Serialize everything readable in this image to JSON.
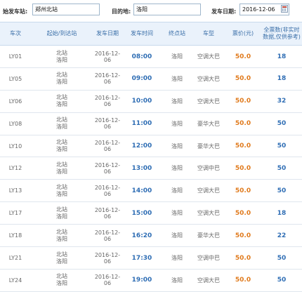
{
  "search": {
    "from_label": "始发车站:",
    "from_value": "郑州北站",
    "to_label": "目的地:",
    "to_value": "洛阳",
    "date_label": "发车日期:",
    "date_value": "2016-12-06"
  },
  "table": {
    "headers": [
      "车次",
      "起始/到达站",
      "发车日期",
      "发车时间",
      "终点站",
      "车型",
      "票价(元)",
      "全票数(非实时\n数据,仅供参考)"
    ],
    "rows": [
      {
        "code": "LY01",
        "from": "北站",
        "to": "洛阳",
        "date": "2016-12-06",
        "time": "08:00",
        "terminal": "洛阳",
        "type": "空调大巴",
        "price": "50.0",
        "seats": "18"
      },
      {
        "code": "LY05",
        "from": "北站",
        "to": "洛阳",
        "date": "2016-12-06",
        "time": "09:00",
        "terminal": "洛阳",
        "type": "空调大巴",
        "price": "50.0",
        "seats": "18"
      },
      {
        "code": "LY06",
        "from": "北站",
        "to": "洛阳",
        "date": "2016-12-06",
        "time": "10:00",
        "terminal": "洛阳",
        "type": "空调大巴",
        "price": "50.0",
        "seats": "32"
      },
      {
        "code": "LY08",
        "from": "北站",
        "to": "洛阳",
        "date": "2016-12-06",
        "time": "11:00",
        "terminal": "洛阳",
        "type": "豪华大巴",
        "price": "50.0",
        "seats": "50"
      },
      {
        "code": "LY10",
        "from": "北站",
        "to": "洛阳",
        "date": "2016-12-06",
        "time": "12:00",
        "terminal": "洛阳",
        "type": "豪华大巴",
        "price": "50.0",
        "seats": "50"
      },
      {
        "code": "LY12",
        "from": "北站",
        "to": "洛阳",
        "date": "2016-12-06",
        "time": "13:00",
        "terminal": "洛阳",
        "type": "空调中巴",
        "price": "50.0",
        "seats": "50"
      },
      {
        "code": "LY13",
        "from": "北站",
        "to": "洛阳",
        "date": "2016-12-06",
        "time": "14:00",
        "terminal": "洛阳",
        "type": "空调大巴",
        "price": "50.0",
        "seats": "50"
      },
      {
        "code": "LY17",
        "from": "北站",
        "to": "洛阳",
        "date": "2016-12-06",
        "time": "15:00",
        "terminal": "洛阳",
        "type": "空调大巴",
        "price": "50.0",
        "seats": "18"
      },
      {
        "code": "LY18",
        "from": "北站",
        "to": "洛阳",
        "date": "2016-12-06",
        "time": "16:20",
        "terminal": "洛阳",
        "type": "豪华大巴",
        "price": "50.0",
        "seats": "22"
      },
      {
        "code": "LY21",
        "from": "北站",
        "to": "洛阳",
        "date": "2016-12-06",
        "time": "17:30",
        "terminal": "洛阳",
        "type": "空调中巴",
        "price": "50.0",
        "seats": "50"
      },
      {
        "code": "LY24",
        "from": "北站",
        "to": "洛阳",
        "date": "2016-12-06",
        "time": "19:00",
        "terminal": "洛阳",
        "type": "空调大巴",
        "price": "50.0",
        "seats": "50"
      }
    ]
  },
  "colors": {
    "header_bg": "#eaf2fb",
    "header_text": "#3a6fa8",
    "time_text": "#2e6db4",
    "price_text": "#e07a1c"
  },
  "icons": {
    "date_picker": "calendar-icon"
  }
}
